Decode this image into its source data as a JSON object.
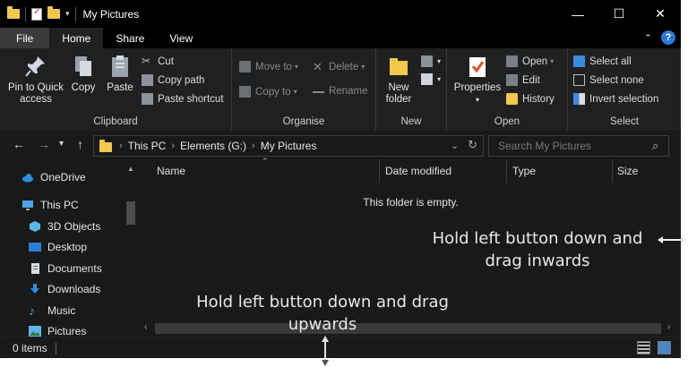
{
  "window": {
    "title": "My Pictures",
    "controls": [
      "—",
      "☐",
      "✕"
    ]
  },
  "tabs": {
    "file": "File",
    "items": [
      "Home",
      "Share",
      "View"
    ]
  },
  "ribbon": {
    "clipboard": {
      "label": "Clipboard",
      "pin_label_1": "Pin to Quick",
      "pin_label_2": "access",
      "copy": "Copy",
      "paste": "Paste",
      "cut": "Cut",
      "copy_path": "Copy path",
      "paste_shortcut": "Paste shortcut"
    },
    "organise": {
      "label": "Organise",
      "move_to": "Move to",
      "copy_to": "Copy to",
      "delete": "Delete",
      "rename": "Rename"
    },
    "new": {
      "label": "New",
      "new_folder_1": "New",
      "new_folder_2": "folder"
    },
    "open": {
      "label": "Open",
      "properties": "Properties",
      "open": "Open",
      "edit": "Edit",
      "history": "History"
    },
    "select": {
      "label": "Select",
      "select_all": "Select all",
      "select_none": "Select none",
      "invert_selection": "Invert selection"
    }
  },
  "address": {
    "crumbs": [
      "This PC",
      "Elements (G:)",
      "My Pictures"
    ],
    "search_placeholder": "Search My Pictures"
  },
  "nav": {
    "items": [
      "OneDrive",
      "This PC",
      "3D Objects",
      "Desktop",
      "Documents",
      "Downloads",
      "Music",
      "Pictures"
    ]
  },
  "content": {
    "columns": [
      "Name",
      "Date modified",
      "Type",
      "Size"
    ],
    "empty_message": "This folder is empty."
  },
  "status": {
    "items_count": "0 items"
  },
  "annotations": {
    "right_1": "Hold left button down and",
    "right_2": "drag inwards",
    "bottom_1": "Hold left button down and drag",
    "bottom_2": "upwards"
  },
  "colors": {
    "accent": "#2b78d6",
    "folder": "#f2c94c",
    "background": "#191919"
  }
}
